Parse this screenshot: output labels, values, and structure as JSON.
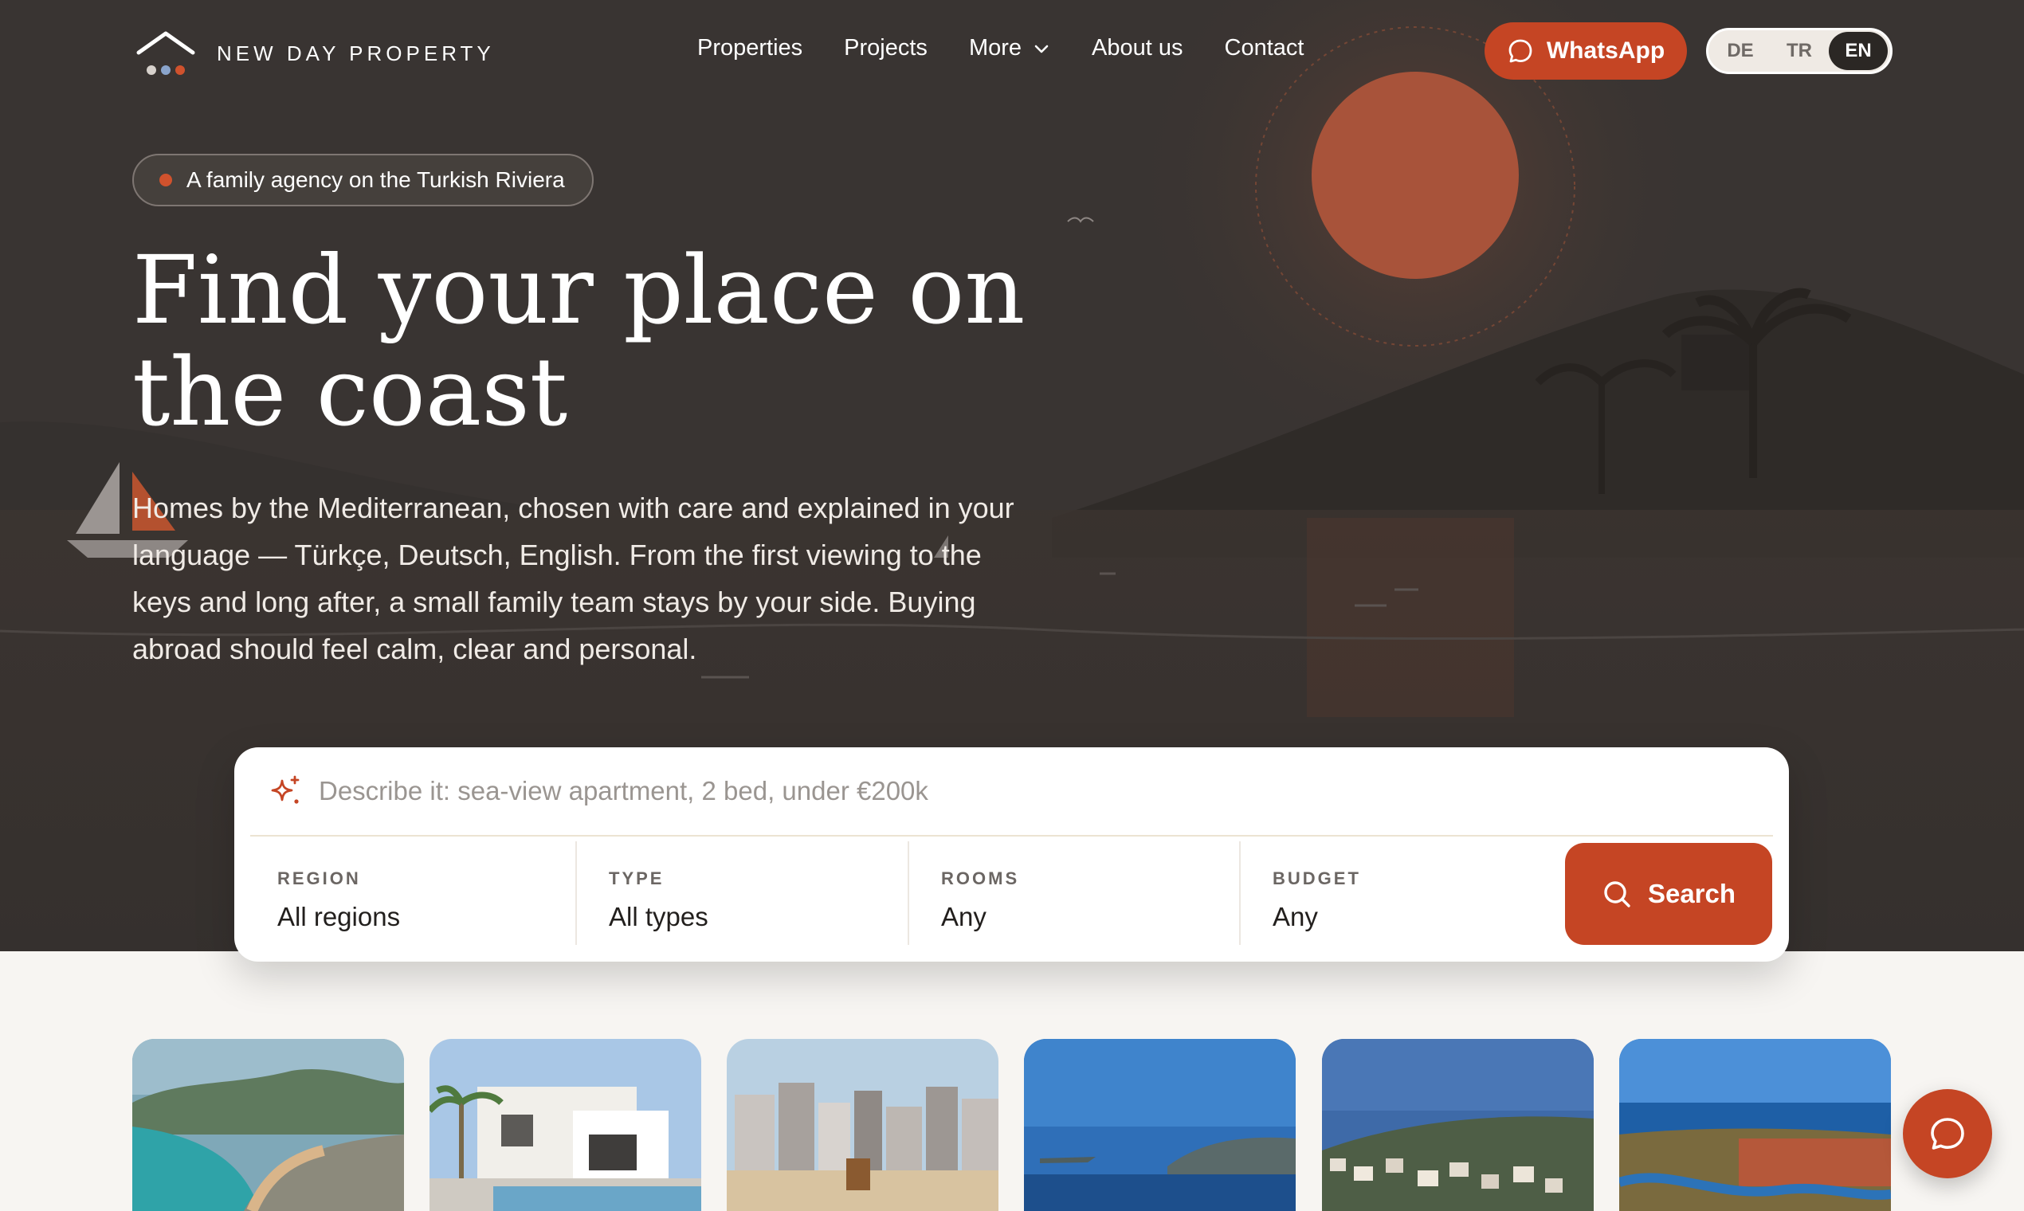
{
  "nav": {
    "brand": "NEW DAY PROPERTY",
    "links": [
      "Properties",
      "Projects",
      "More",
      "About us",
      "Contact"
    ],
    "whatsapp_label": "WhatsApp",
    "languages": [
      "DE",
      "TR",
      "EN"
    ],
    "active_language": "EN"
  },
  "hero": {
    "tag": "A family agency on the Turkish Riviera",
    "headline": "Find your place on the coast",
    "lead": "Homes by the Mediterranean, chosen with care and explained in your language — Türkçe, Deutsch, English. From the first viewing to the keys and long after, a small family team stays by your side. Buying abroad should feel calm, clear and personal."
  },
  "search": {
    "placeholder": "Describe it: sea-view apartment, 2 bed, under €200k",
    "fields": [
      {
        "label": "REGION",
        "value": "All regions"
      },
      {
        "label": "TYPE",
        "value": "All types"
      },
      {
        "label": "ROOMS",
        "value": "Any"
      },
      {
        "label": "BUDGET",
        "value": "Any"
      }
    ],
    "button_label": "Search"
  },
  "thumbnails": [
    "bay-beach-photo",
    "villa-pool-photo",
    "city-beach-photo",
    "sea-island-photo",
    "hillside-town-photo",
    "river-town-photo"
  ],
  "colors": {
    "accent": "#c54524",
    "hero_bg": "#3a3532",
    "page_bg": "#f7f5f2"
  },
  "icons": {
    "logo": "house-logo-icon",
    "whatsapp": "chat-bubble-icon",
    "search_sparkle": "sparkle-icon",
    "search_button": "search-icon",
    "chat_fab": "chat-bubble-icon"
  }
}
